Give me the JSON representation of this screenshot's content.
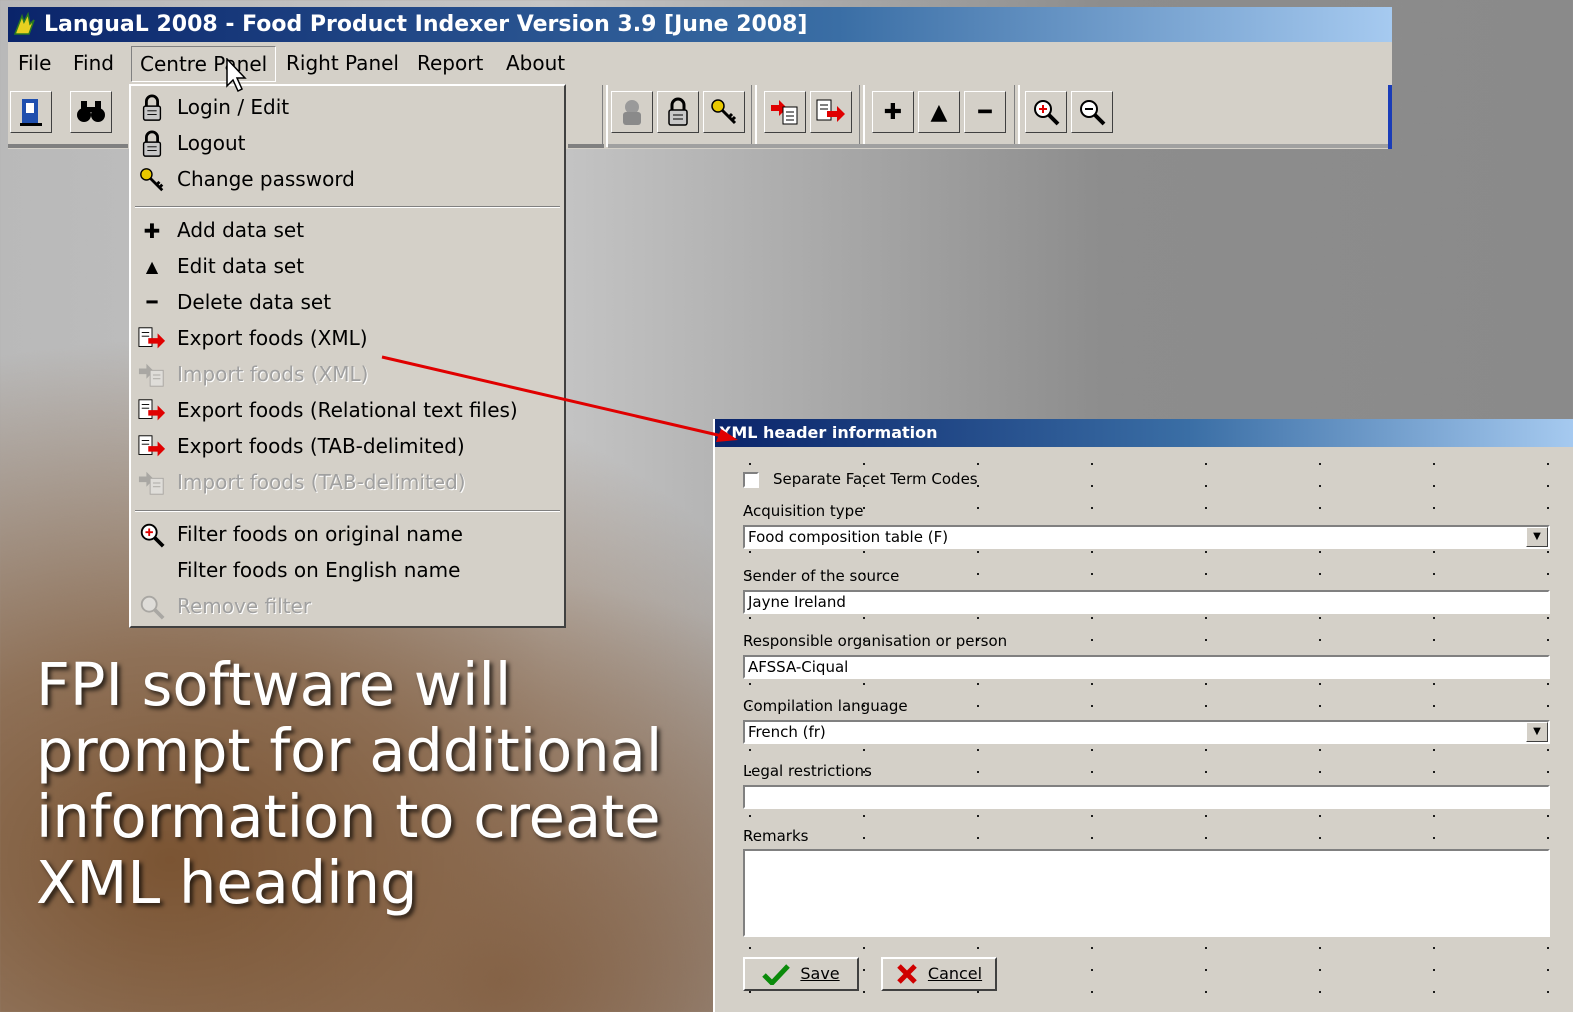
{
  "window": {
    "title": "LanguaL 2008  -  Food Product Indexer Version 3.9  [June 2008]"
  },
  "menubar": {
    "items": [
      {
        "label": "File"
      },
      {
        "label": "Find"
      },
      {
        "label": "Centre Panel"
      },
      {
        "label": "Right Panel"
      },
      {
        "label": "Report"
      },
      {
        "label": "About"
      }
    ]
  },
  "toolbar": {
    "icons": [
      "exit-icon",
      "binoculars-icon",
      "user-lock-icon",
      "lock-icon",
      "key-icon",
      "import-icon",
      "export-icon",
      "plus-icon",
      "up-triangle-icon",
      "minus-icon",
      "zoom-in-icon",
      "zoom-out-icon"
    ]
  },
  "centre_panel_menu": {
    "items": [
      {
        "label": "Login / Edit",
        "icon": "lock-icon",
        "enabled": true
      },
      {
        "label": "Logout",
        "icon": "lock-icon",
        "enabled": true
      },
      {
        "label": "Change password",
        "icon": "key-icon",
        "enabled": true
      },
      {
        "label": "Add data set",
        "icon": "plus-icon",
        "enabled": true
      },
      {
        "label": "Edit data set",
        "icon": "up-triangle-icon",
        "enabled": true
      },
      {
        "label": "Delete data set",
        "icon": "minus-icon",
        "enabled": true
      },
      {
        "label": "Export foods (XML)",
        "icon": "export-icon",
        "enabled": true
      },
      {
        "label": "Import foods (XML)",
        "icon": "import-icon",
        "enabled": false
      },
      {
        "label": "Export foods (Relational text files)",
        "icon": "export-icon",
        "enabled": true
      },
      {
        "label": "Export foods (TAB-delimited)",
        "icon": "export-icon",
        "enabled": true
      },
      {
        "label": "Import foods (TAB-delimited)",
        "icon": "import-icon",
        "enabled": false
      },
      {
        "label": "Filter foods on original name",
        "icon": "zoom-in-icon",
        "enabled": true
      },
      {
        "label": "Filter foods on English name",
        "icon": "",
        "enabled": true
      },
      {
        "label": "Remove filter",
        "icon": "zoom-icon",
        "enabled": false
      }
    ]
  },
  "caption": {
    "text": "FPI software will prompt for additional information to create XML heading"
  },
  "xml_dialog": {
    "title": "XML header information",
    "separate_codes_label": "Separate Facet Term Codes",
    "separate_codes_checked": false,
    "acquisition_label": "Acquisition type",
    "acquisition_value": "Food composition table (F)",
    "sender_label": "Sender of the source",
    "sender_value": "Jayne Ireland",
    "responsible_label": "Responsible organisation or person",
    "responsible_value": "AFSSA-Ciqual",
    "language_label": "Compilation language",
    "language_value": "French (fr)",
    "legal_label": "Legal restrictions",
    "legal_value": "",
    "remarks_label": "Remarks",
    "remarks_value": "",
    "save_label": "Save",
    "cancel_label": "Cancel"
  },
  "colors": {
    "title_blue": "#0a246a",
    "menu_bg": "#d4d0c8",
    "arrow_red": "#e00000"
  }
}
